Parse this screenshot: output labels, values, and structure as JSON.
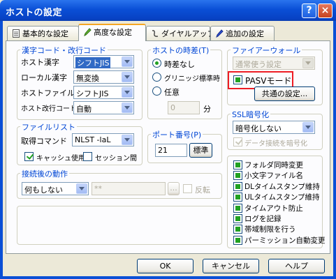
{
  "window": {
    "title": "ホストの設定",
    "help_label": "?",
    "close_label": "×"
  },
  "tabs": [
    {
      "label": "基本的な設定"
    },
    {
      "label": "高度な設定",
      "active": true
    },
    {
      "label": "ダイヤルアップ"
    },
    {
      "label": "追加の設定"
    }
  ],
  "kanji": {
    "group_label": "漢字コード・改行コード",
    "host_kanji": {
      "label": "ホスト漢字",
      "value": "シフトJIS"
    },
    "local_kanji": {
      "label": "ローカル漢字",
      "value": "無変換"
    },
    "host_filename": {
      "label": "ホストファイル名",
      "value": "シフトJIS"
    },
    "host_newline": {
      "label": "ホスト改行コード",
      "value": "自動"
    }
  },
  "timezone": {
    "group_label": "ホストの時差(T)",
    "options": [
      "時差なし",
      "グリニッジ標準時",
      "任意"
    ],
    "selected": 0,
    "offset_value": "0",
    "unit": "分"
  },
  "firewall": {
    "group_label": "ファイアーウォール",
    "mode_value": "通常使う設定",
    "pasv_label": "PASVモード",
    "pasv_checked": true,
    "common_button": "共通の設定..."
  },
  "filelist": {
    "group_label": "ファイルリスト",
    "command_label": "取得コマンド",
    "command_value": "NLST -laL",
    "cache_label": "キャッシュ使用",
    "cache_checked": true,
    "session_label": "セッション間",
    "session_checked": false
  },
  "port": {
    "group_label": "ポート番号(P)",
    "value": "21",
    "standard_button": "標準"
  },
  "ssl": {
    "group_label": "SSL暗号化",
    "value": "暗号化しない",
    "data_encrypt_label": "データ接続を暗号化",
    "data_encrypt_checked": true
  },
  "after_connect": {
    "group_label": "接続後の動作",
    "action_value": "何もしない",
    "path_value": "**",
    "browse_button": "...",
    "reverse_label": "反転"
  },
  "options": [
    {
      "label": "フォルダ同時変更",
      "checked": true
    },
    {
      "label": "小文字ファイル名",
      "checked": true
    },
    {
      "label": "DLタイムスタンプ維持",
      "checked": true
    },
    {
      "label": "ULタイムスタンプ維持",
      "checked": true
    },
    {
      "label": "タイムアウト防止",
      "checked": true
    },
    {
      "label": "ログを記録",
      "checked": true
    },
    {
      "label": "帯域制限を行う",
      "checked": true
    },
    {
      "label": "パーミッション自動変更",
      "checked": true
    }
  ],
  "buttons": {
    "ok": "OK",
    "cancel": "キャンセル",
    "help": "ヘルプ"
  },
  "colors": {
    "accent": "#0046d5",
    "highlight": "#ee1c24",
    "titlebar": "#0a4fd6"
  }
}
